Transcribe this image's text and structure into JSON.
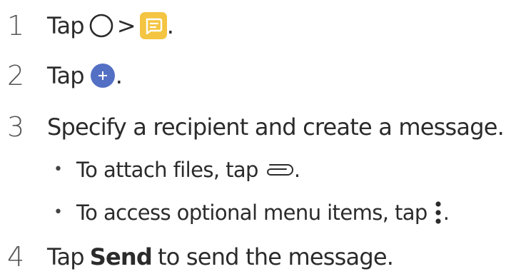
{
  "colors": {
    "text": "#2b2b2b",
    "message_icon_bg": "#f4c542",
    "plus_icon_bg": "#5470c4"
  },
  "icons": {
    "home": "circle-outline-icon",
    "messaging": "message-bubble-icon",
    "plus": "plus-icon",
    "attach": "paperclip-icon",
    "more": "vertical-ellipsis-icon"
  },
  "steps": [
    {
      "number": "1",
      "text_before": "Tap",
      "separator": ">",
      "period": "."
    },
    {
      "number": "2",
      "text_before": "Tap",
      "period": "."
    },
    {
      "number": "3",
      "text": "Specify a recipient and create a message."
    },
    {
      "number": "4",
      "text_before": "Tap",
      "bold": "Send",
      "text_after": "to send the message."
    }
  ],
  "bullets": [
    {
      "marker": "•",
      "text": "To attach files, tap",
      "period": "."
    },
    {
      "marker": "•",
      "text": "To access optional menu items, tap",
      "period": "."
    }
  ]
}
